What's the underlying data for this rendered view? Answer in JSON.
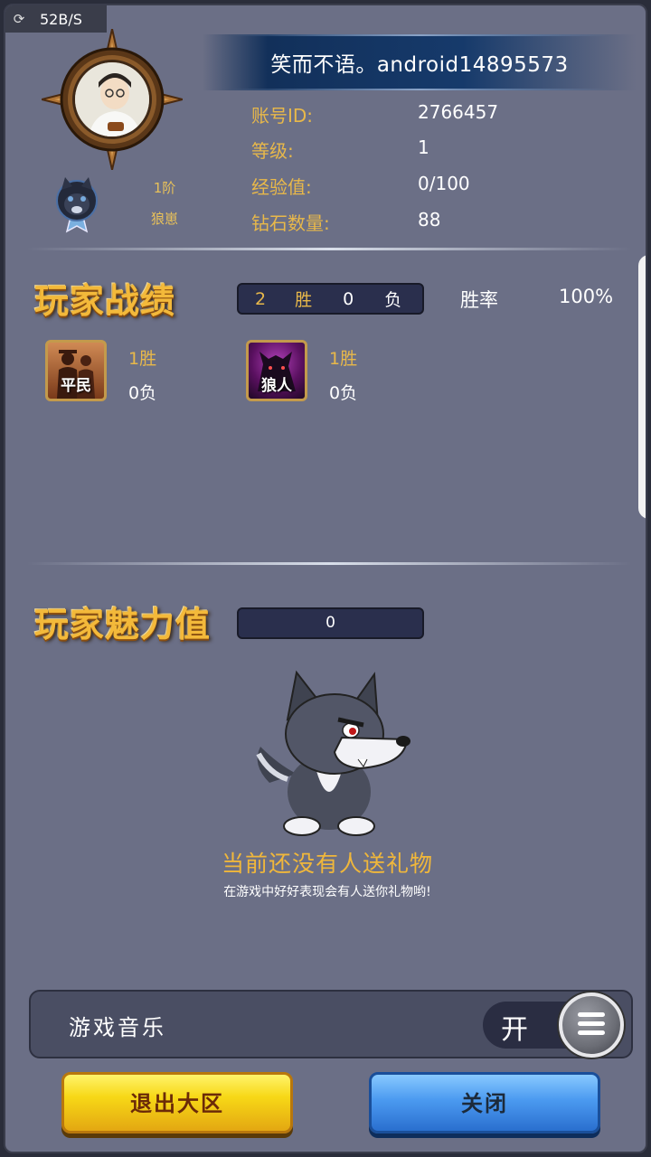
{
  "status_bar": {
    "speed": "52B/S",
    "icon": "sync-icon"
  },
  "profile": {
    "name": "笑而不语。android14895573",
    "rank_level": "1阶",
    "rank_title": "狼崽",
    "fields": [
      {
        "label": "账号ID:",
        "value": "2766457"
      },
      {
        "label": "等级:",
        "value": "1"
      },
      {
        "label": "经验值:",
        "value": "0/100"
      },
      {
        "label": "钻石数量:",
        "value": "88"
      }
    ]
  },
  "record": {
    "title": "玩家战绩",
    "wins": "2",
    "wins_label": "胜",
    "losses": "0",
    "losses_label": "负",
    "winrate_label": "胜率",
    "winrate_value": "100%",
    "roles": [
      {
        "name": "平民",
        "wins": "1胜",
        "losses": "0负"
      },
      {
        "name": "狼人",
        "wins": "1胜",
        "losses": "0负"
      }
    ]
  },
  "charm": {
    "title": "玩家魅力值",
    "value": "0",
    "empty_title": "当前还没有人送礼物",
    "empty_sub": "在游戏中好好表现会有人送你礼物哟!"
  },
  "settings": {
    "music_label": "游戏音乐",
    "music_state": "开"
  },
  "buttons": {
    "exit_label": "退出大区",
    "close_label": "关闭"
  },
  "colors": {
    "panel_bg": "#6b6f86",
    "accent_gold": "#e8b84a",
    "exit_yellow": "#f7d816",
    "close_blue": "#4b9af0"
  }
}
